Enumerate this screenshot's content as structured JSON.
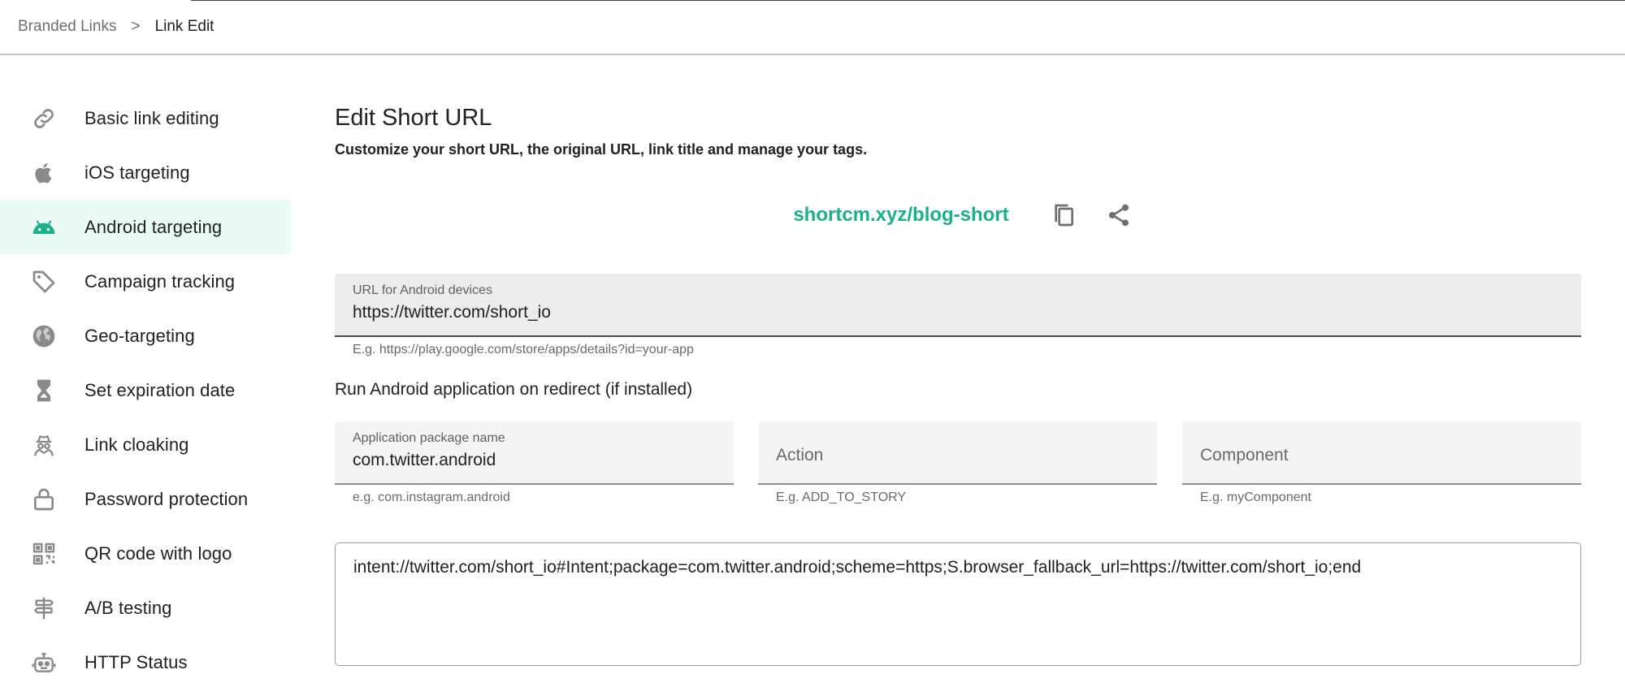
{
  "breadcrumb": {
    "parent": "Branded Links",
    "separator": ">",
    "current": "Link Edit"
  },
  "sidebar": {
    "items": [
      {
        "label": "Basic link editing",
        "icon": "link-icon",
        "active": false
      },
      {
        "label": "iOS targeting",
        "icon": "apple-icon",
        "active": false
      },
      {
        "label": "Android targeting",
        "icon": "android-icon",
        "active": true
      },
      {
        "label": "Campaign tracking",
        "icon": "tag-icon",
        "active": false
      },
      {
        "label": "Geo-targeting",
        "icon": "globe-icon",
        "active": false
      },
      {
        "label": "Set expiration date",
        "icon": "hourglass-icon",
        "active": false
      },
      {
        "label": "Link cloaking",
        "icon": "spy-icon",
        "active": false
      },
      {
        "label": "Password protection",
        "icon": "lock-icon",
        "active": false
      },
      {
        "label": "QR code with logo",
        "icon": "qr-code-icon",
        "active": false
      },
      {
        "label": "A/B testing",
        "icon": "signpost-icon",
        "active": false
      },
      {
        "label": "HTTP Status",
        "icon": "robot-icon",
        "active": false
      }
    ]
  },
  "main": {
    "title": "Edit Short URL",
    "subtitle": "Customize your short URL, the original URL, link title and manage your tags.",
    "short_url": "shortcm.xyz/blog-short",
    "android_url": {
      "label": "URL for Android devices",
      "value": "https://twitter.com/short_io",
      "helper": "E.g. https://play.google.com/store/apps/details?id=your-app"
    },
    "run_app_title": "Run Android application on redirect (if installed)",
    "package": {
      "label": "Application package name",
      "value": "com.twitter.android",
      "helper": "e.g. com.instagram.android"
    },
    "action": {
      "placeholder": "Action",
      "helper": "E.g. ADD_TO_STORY"
    },
    "component": {
      "placeholder": "Component",
      "helper": "E.g. myComponent"
    },
    "intent": "intent://twitter.com/short_io#Intent;package=com.twitter.android;scheme=https;S.browser_fallback_url=https://twitter.com/short_io;end"
  },
  "colors": {
    "accent": "#1ab189",
    "active_bg": "#eafaf4",
    "icon_gray": "#8a8a8a"
  }
}
